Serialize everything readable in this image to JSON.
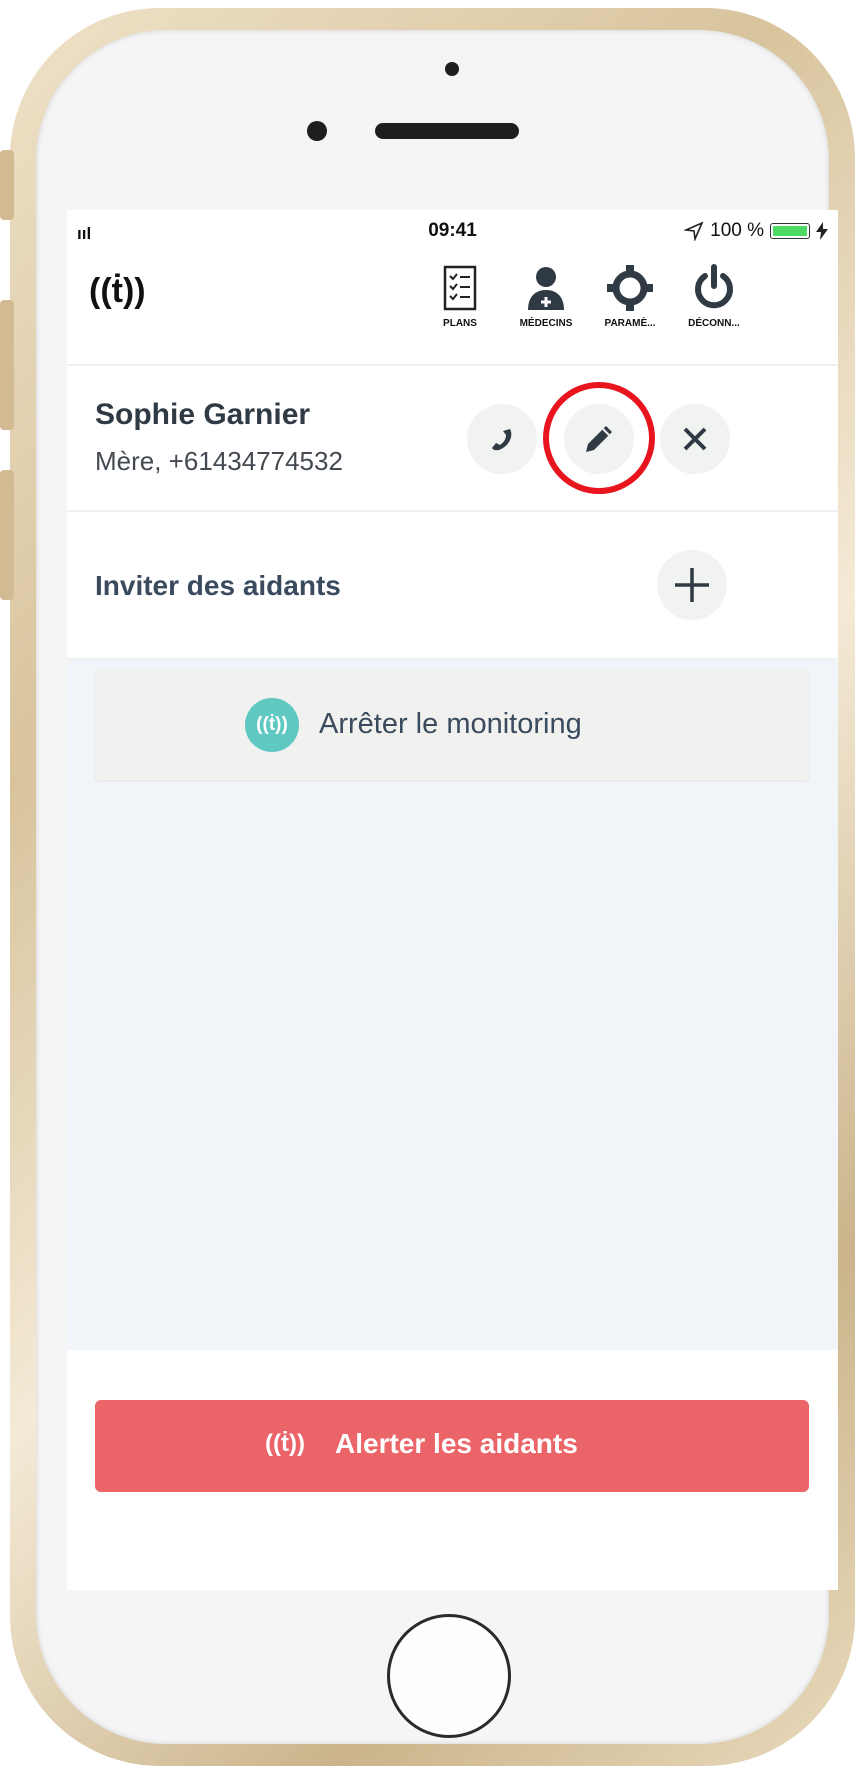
{
  "status_bar": {
    "signal": "ııl",
    "time": "09:41",
    "battery_percent": "100 %"
  },
  "nav": {
    "logo_glyph": "((ṫ))",
    "items": [
      {
        "label": "PLANS",
        "icon": "checklist-icon"
      },
      {
        "label": "MÉDECINS",
        "icon": "doctor-icon"
      },
      {
        "label": "PARAMÈ...",
        "icon": "gear-icon"
      },
      {
        "label": "DÉCONN...",
        "icon": "power-icon"
      }
    ]
  },
  "contact": {
    "name": "Sophie Garnier",
    "detail": "Mère, +61434774532"
  },
  "invite": {
    "label": "Inviter des aidants"
  },
  "monitoring": {
    "icon_glyph": "((ṫ))",
    "label": "Arrêter le monitoring"
  },
  "alert": {
    "icon_glyph": "((ṫ))",
    "label": "Alerter les aidants"
  },
  "colors": {
    "alert_red": "#eb6468",
    "monitor_teal": "#5fc8c0",
    "highlight_red": "#e8141e",
    "text_dark": "#3b4b5e"
  }
}
